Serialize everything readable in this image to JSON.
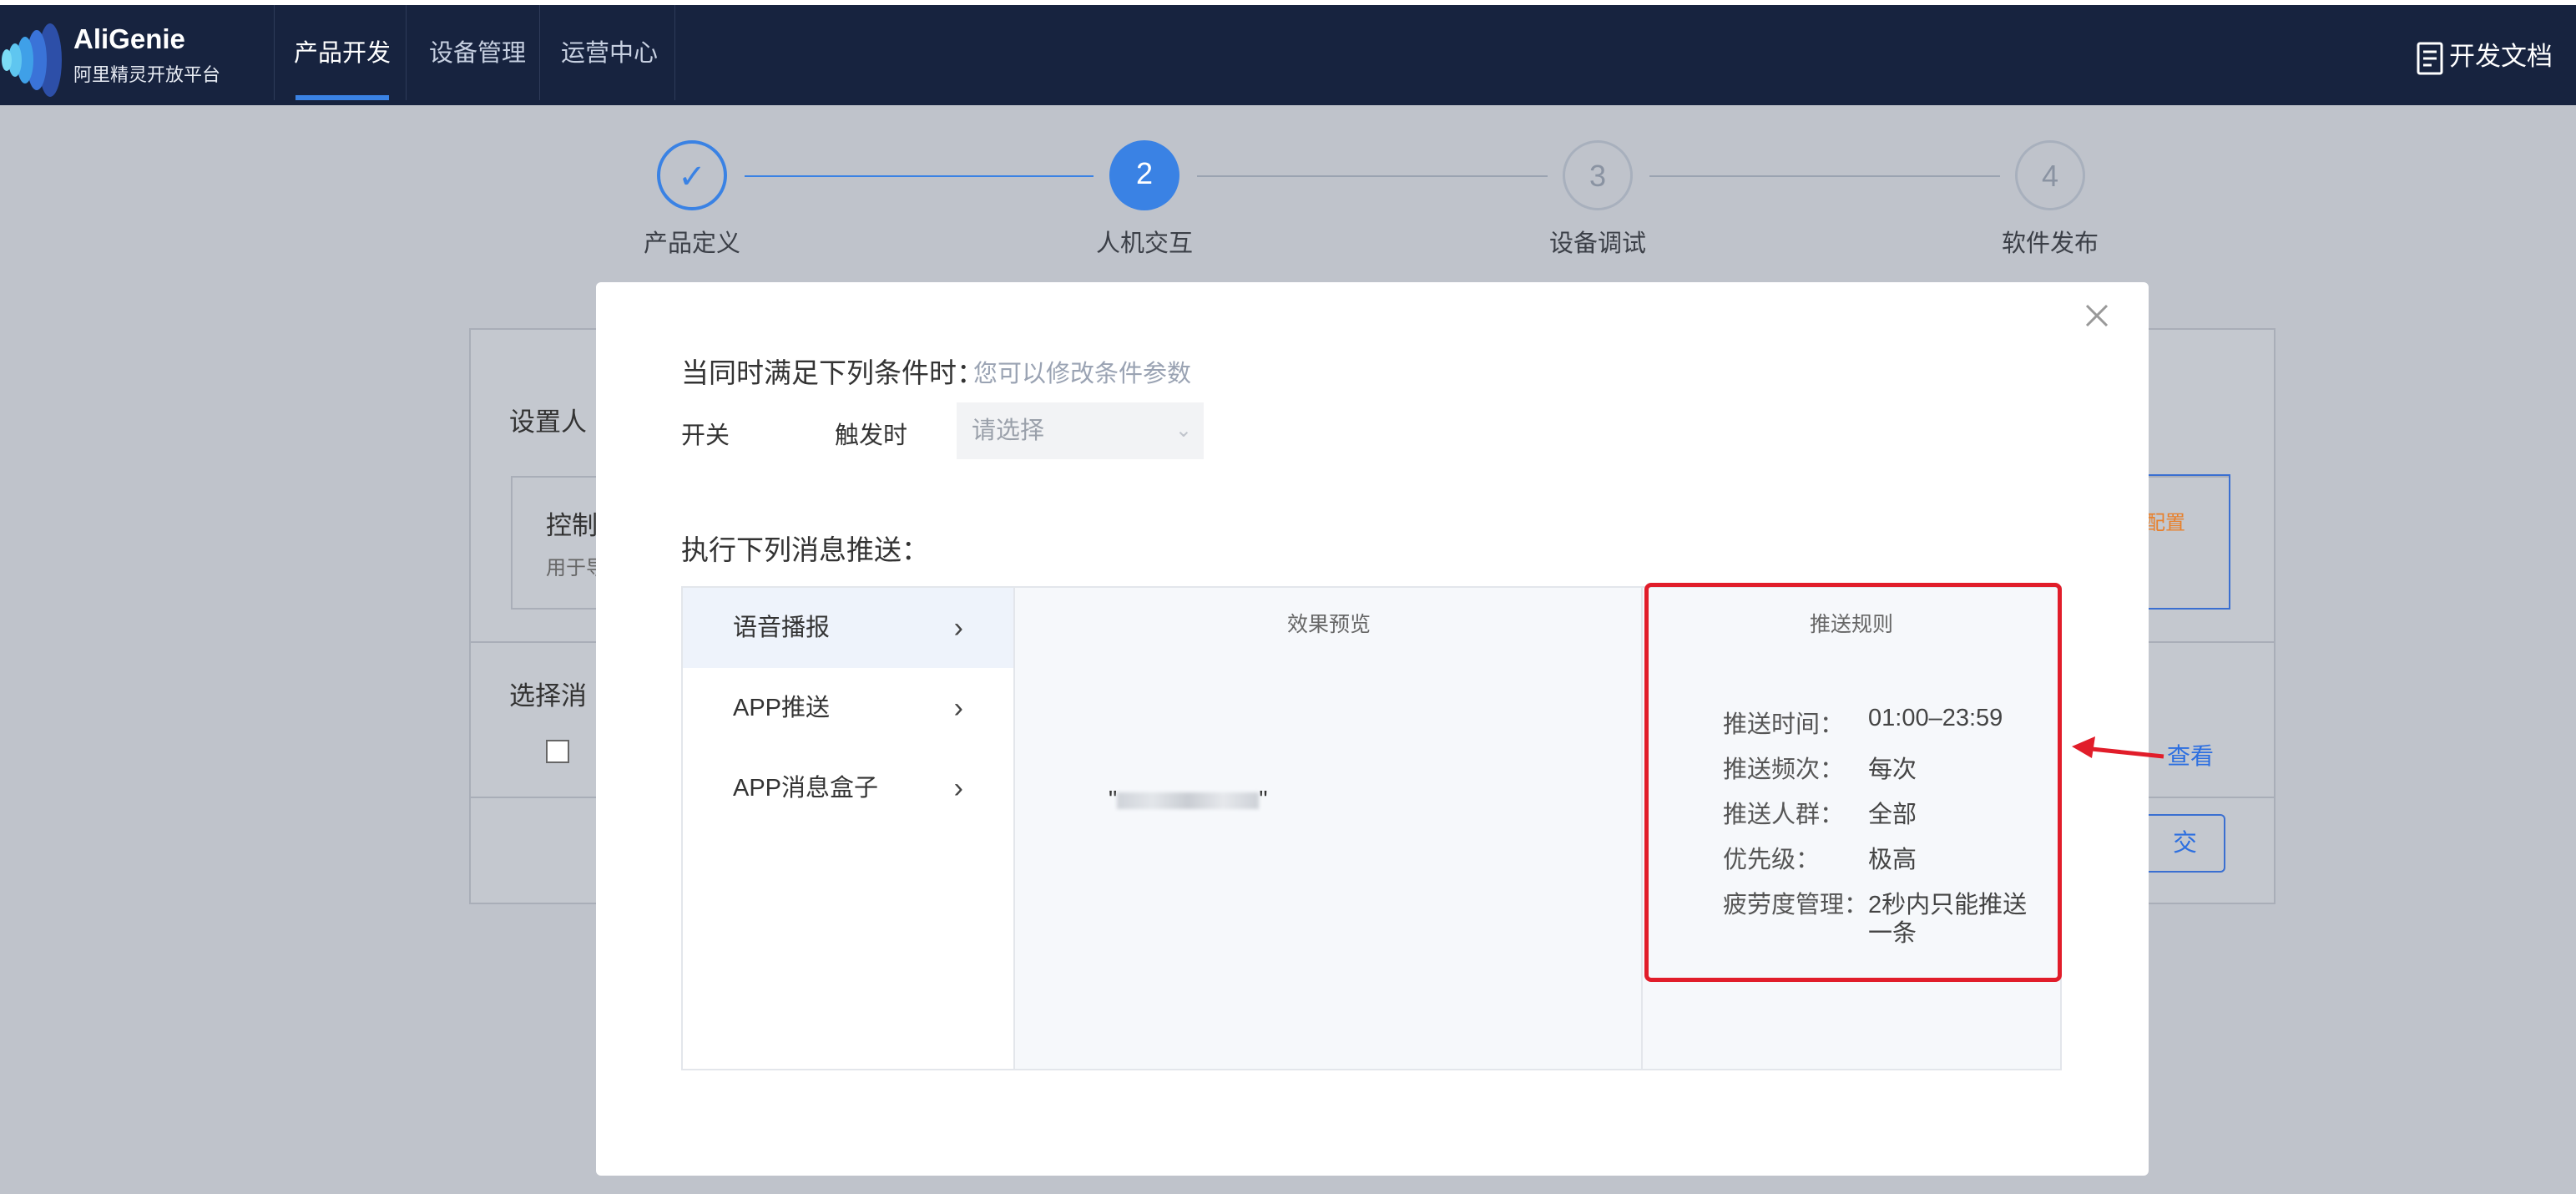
{
  "brand": {
    "name": "AliGenie",
    "subtitle": "阿里精灵开放平台"
  },
  "nav": {
    "items": [
      "产品开发",
      "设备管理",
      "运营中心"
    ],
    "active_index": 0,
    "doc_link": "开发文档"
  },
  "steps": [
    {
      "number": "✓",
      "label": "产品定义",
      "status": "done"
    },
    {
      "number": "2",
      "label": "人机交互",
      "status": "active"
    },
    {
      "number": "3",
      "label": "设备调试",
      "status": "pending"
    },
    {
      "number": "4",
      "label": "软件发布",
      "status": "pending"
    }
  ],
  "background": {
    "section1_title": "设置人",
    "card_title": "控制",
    "card_desc": "用于导",
    "section2_title": "选择消",
    "config_link": "配置",
    "submit_btn": "交"
  },
  "modal": {
    "condition_title": "当同时满足下列条件时：",
    "condition_hint": "您可以修改条件参数",
    "switch_label": "开关",
    "trigger_label": "触发时",
    "select_placeholder": "请选择",
    "push_title": "执行下列消息推送：",
    "tabs": [
      "语音播报",
      "APP推送",
      "APP消息盒子"
    ],
    "active_tab": 0,
    "preview_header": "效果预览",
    "preview_quote_open": "\"",
    "preview_quote_close": "\"",
    "rules_header": "推送规则",
    "rules": [
      {
        "key": "推送时间：",
        "value": "01:00–23:59"
      },
      {
        "key": "推送频次：",
        "value": "每次"
      },
      {
        "key": "推送人群：",
        "value": "全部"
      },
      {
        "key": "优先级：",
        "value": "极高"
      },
      {
        "key": "疲劳度管理：",
        "value": "2秒内只能推送",
        "value2": "一条"
      }
    ]
  },
  "annotation": {
    "view_link": "查看"
  },
  "colors": {
    "nav_bg": "#17233f",
    "accent": "#3a82e4",
    "highlight_red": "#e11d2a"
  }
}
